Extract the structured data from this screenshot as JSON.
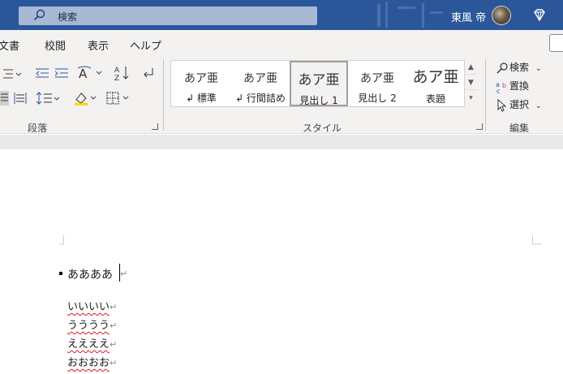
{
  "titlebar": {
    "search_placeholder": "検索",
    "user_name": "東風 帝",
    "colors": {
      "bar": "#2b579a",
      "search_bg": "#a8b9d6"
    }
  },
  "menu": {
    "items": [
      "文書",
      "校閲",
      "表示",
      "ヘルプ"
    ]
  },
  "ribbon": {
    "paragraph_group_label": "段落",
    "styles_group_label": "スタイル",
    "editing_group_label": "編集",
    "styles": [
      {
        "sample": "あア亜",
        "name": "↲ 標準"
      },
      {
        "sample": "あア亜",
        "name": "↲ 行間詰め"
      },
      {
        "sample": "あア亜",
        "name": "見出し 1"
      },
      {
        "sample": "あア亜",
        "name": "見出し 2"
      },
      {
        "sample": "あア亜",
        "name": "表題"
      }
    ],
    "edit_items": [
      "検索",
      "置換",
      "選択"
    ]
  },
  "document": {
    "heading_line": "ああああ",
    "lines": [
      "いいいい",
      "うううう",
      "ええええ",
      "おおおお"
    ],
    "paragraph_mark": "↵"
  }
}
